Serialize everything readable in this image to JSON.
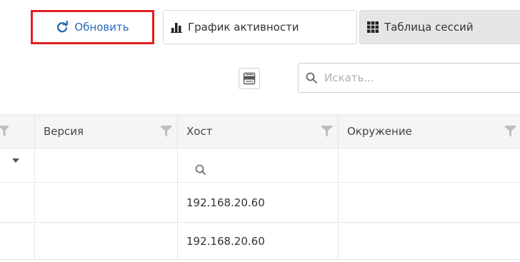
{
  "toolbar": {
    "refresh_label": "Обновить",
    "activity_chart_label": "График активности",
    "sessions_table_label": "Таблица сессий"
  },
  "search": {
    "placeholder": "Искать..."
  },
  "grid": {
    "columns": [
      "Версия",
      "Хост",
      "Окружение"
    ],
    "rows": [
      {
        "version": "",
        "host": "192.168.20.60",
        "environment": ""
      },
      {
        "version": "",
        "host": "192.168.20.60",
        "environment": ""
      }
    ]
  },
  "colors": {
    "link_blue": "#2a6ab5",
    "highlight_red": "#e02020",
    "funnel_gray": "#bdbdbd",
    "active_tab_bg": "#e6e6e6"
  },
  "icons": {
    "refresh": "refresh-icon",
    "activity_chart": "bar-chart-icon",
    "sessions_table": "grid-icon",
    "export": "excel-export-icon",
    "search": "search-icon",
    "filter": "funnel-filter-icon"
  }
}
